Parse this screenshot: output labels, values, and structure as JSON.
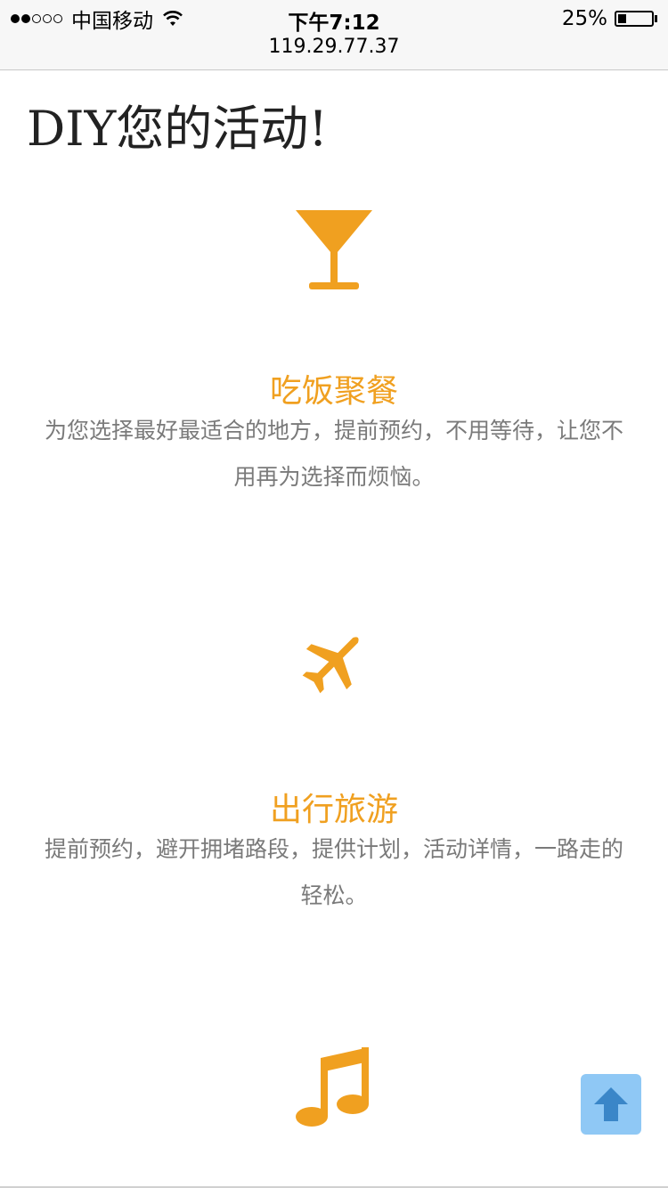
{
  "status_bar": {
    "carrier": "中国移动",
    "time": "下午7:12",
    "url": "119.29.77.37",
    "battery": "25%",
    "battery_level": 0.25,
    "signal_bars_filled": 2,
    "signal_bars_total": 5
  },
  "page": {
    "title": "DIY您的活动!"
  },
  "features": [
    {
      "icon": "cocktail-glass-icon",
      "title": "吃饭聚餐",
      "description": "为您选择最好最适合的地方，提前预约，不用等待，让您不用再为选择而烦恼。"
    },
    {
      "icon": "airplane-icon",
      "title": "出行旅游",
      "description": "提前预约，避开拥堵路段，提供计划，活动详情，一路走的轻松。"
    },
    {
      "icon": "music-note-icon",
      "title": "",
      "description": ""
    }
  ],
  "back_to_top": {
    "icon": "arrow-up-icon"
  },
  "colors": {
    "accent": "#f0a020",
    "text_gray": "#7a7a7a",
    "button_blue": "#8fc8f5",
    "arrow_blue": "#3a86c8"
  }
}
